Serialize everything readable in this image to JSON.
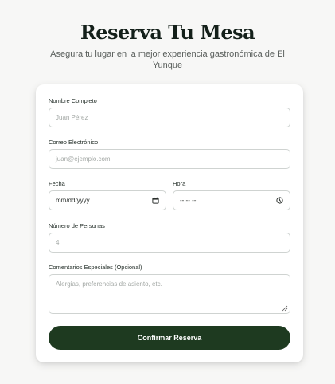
{
  "header": {
    "title": "Reserva Tu Mesa",
    "subtitle": "Asegura tu lugar en la mejor experiencia gastronómica de El Yunque"
  },
  "form": {
    "name": {
      "label": "Nombre Completo",
      "placeholder": "Juan Pérez"
    },
    "email": {
      "label": "Correo Electrónico",
      "placeholder": "juan@ejemplo.com"
    },
    "date": {
      "label": "Fecha",
      "value": "mm/dd/yyyy",
      "icon": "calendar-icon"
    },
    "time": {
      "label": "Hora",
      "value": "--:-- --",
      "icon": "clock-icon"
    },
    "guests": {
      "label": "Número de Personas",
      "value": "4"
    },
    "comments": {
      "label": "Comentarios Especiales (Opcional)",
      "placeholder": "Alergias, preferencias de asiento, etc."
    },
    "submit_label": "Confirmar Reserva"
  },
  "colors": {
    "primary_button": "#1e3a20",
    "background": "#f7f7f6",
    "card": "#ffffff",
    "border": "#cfd3d1"
  }
}
